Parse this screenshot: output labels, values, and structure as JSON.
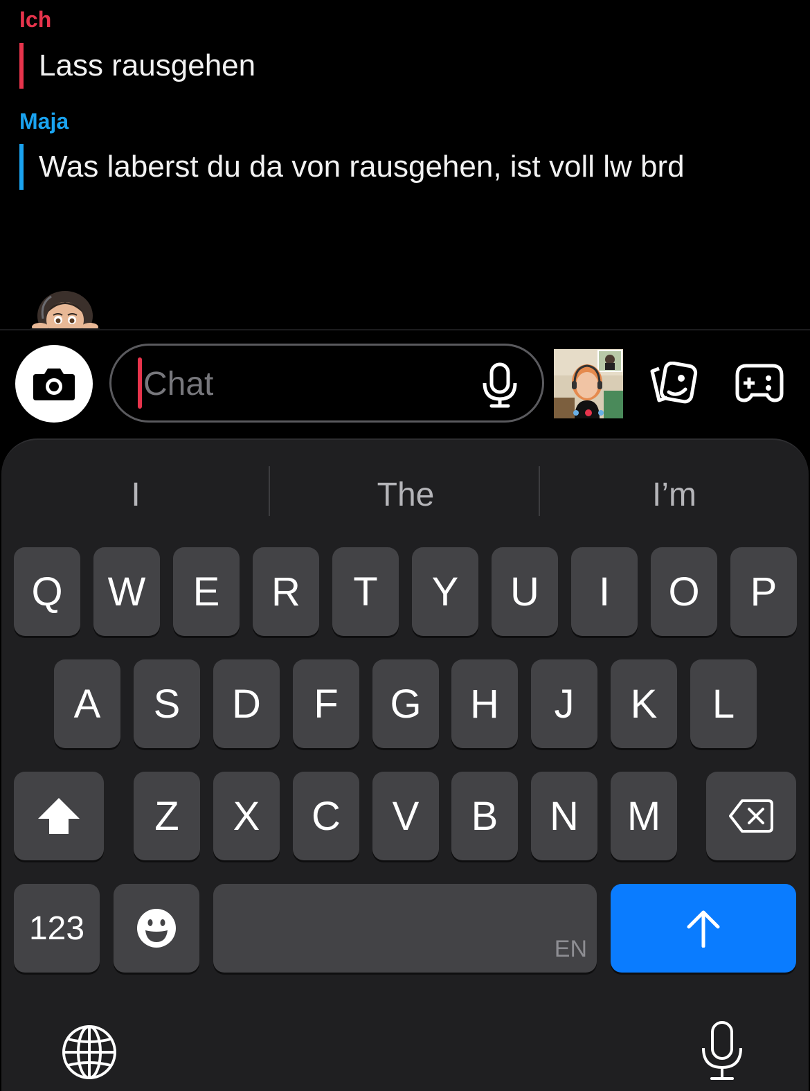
{
  "chat": {
    "messages": [
      {
        "sender": "Ich",
        "sender_color": "#e7344c",
        "text": "Lass rausgehen"
      },
      {
        "sender": "Maja",
        "sender_color": "#1aa3f0",
        "text": "Was laberst du da von rausgehen, ist voll lw brd"
      }
    ]
  },
  "input_bar": {
    "placeholder": "Chat",
    "caret_color": "#e7344c",
    "icons": [
      "camera-icon",
      "microphone-icon",
      "bitmoji-call",
      "memories-icon",
      "games-icon"
    ]
  },
  "keyboard": {
    "suggestions": [
      "I",
      "The",
      "I’m"
    ],
    "row1": [
      "Q",
      "W",
      "E",
      "R",
      "T",
      "Y",
      "U",
      "I",
      "O",
      "P"
    ],
    "row2": [
      "A",
      "S",
      "D",
      "F",
      "G",
      "H",
      "J",
      "K",
      "L"
    ],
    "row3": [
      "Z",
      "X",
      "C",
      "V",
      "B",
      "N",
      "M"
    ],
    "numbers_label": "123",
    "language_label": "EN",
    "enter_color": "#0a7cff"
  }
}
